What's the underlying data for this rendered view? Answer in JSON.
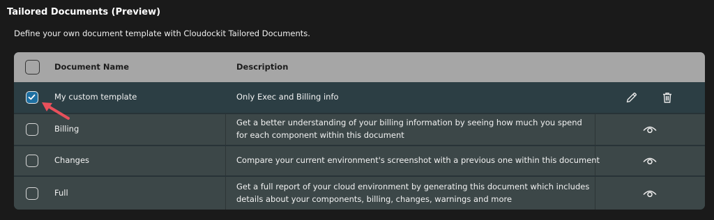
{
  "section": {
    "title": "Tailored Documents (Preview)",
    "description": "Define your own document template with Cloudockit Tailored Documents."
  },
  "table": {
    "headers": {
      "name": "Document Name",
      "description": "Description"
    },
    "rows": [
      {
        "name": "My custom template",
        "description": "Only Exec and Billing info",
        "checked": true,
        "actions": [
          "pencil-icon",
          "trash-icon"
        ]
      },
      {
        "name": "Billing",
        "description": "Get a better understanding of your billing information by seeing how much you spend for each component within this document",
        "checked": false,
        "actions": [
          "eye-icon"
        ]
      },
      {
        "name": "Changes",
        "description": "Compare your current environment's screenshot with a previous one within this document",
        "checked": false,
        "actions": [
          "eye-icon"
        ]
      },
      {
        "name": "Full",
        "description": "Get a full report of your cloud environment by generating this document which includes details about your components, billing, changes, warnings and more",
        "checked": false,
        "actions": [
          "eye-icon"
        ]
      }
    ]
  },
  "colors": {
    "header_bg": "#a6a6a6",
    "row_bg": "#3c4748",
    "selected_row_bg": "#2c3e44",
    "checkbox_checked": "#1e6fa1",
    "annotation_arrow": "#e8505b"
  }
}
